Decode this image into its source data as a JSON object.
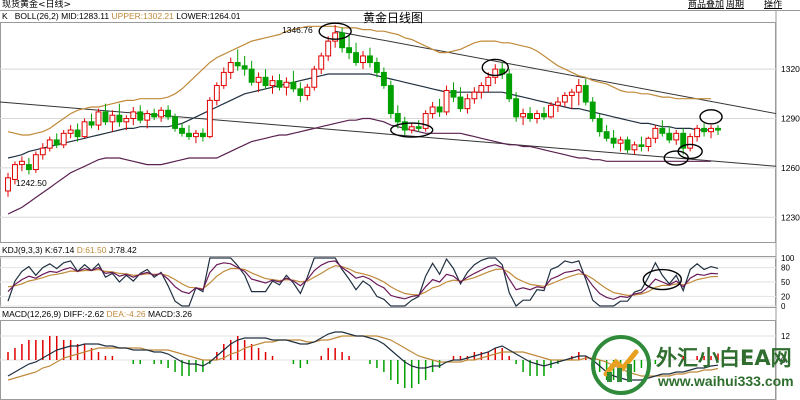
{
  "window": {
    "title": "现货黄金<日线>",
    "links": [
      "商品叠加",
      "周期",
      "操作"
    ]
  },
  "price_panel": {
    "header_prefix": "K",
    "boll_label": "BOLL(26,2)",
    "mid": "MID:1283.11",
    "upper": "UPPER:1302.21",
    "lower": "LOWER:1264.01",
    "chart_title": "黄金日线图",
    "high_label": "1346.76",
    "low_label": "1242.50",
    "axis_ticks": [
      "1320",
      "1290",
      "1260",
      "1230"
    ]
  },
  "kdj_panel": {
    "label": "KDJ(9,3,3)",
    "k": "K:67.14",
    "d": "D:61.50",
    "j": "J:78.42",
    "axis_ticks": [
      "100",
      "80",
      "50",
      "20",
      "0"
    ]
  },
  "macd_panel": {
    "label": "MACD(12,26,9)",
    "diff": "DIFF:-2.62",
    "dea": "DEA:-4.26",
    "macd": "MACD:3.26",
    "axis_ticks": [
      "12",
      "0"
    ]
  },
  "watermark": {
    "brand": "外汇小白EA网",
    "url": "www.waihui333.com"
  },
  "colors": {
    "up": "#e00000",
    "down": "#00a000",
    "boll_upper": "#c08a3a",
    "boll_mid": "#203040",
    "boll_lower": "#5a2050",
    "k_line": "#6a1a5a",
    "d_line": "#c08a3a",
    "j_line": "#203040",
    "trendline": "#333333",
    "ellipse": "#000000"
  },
  "chart_data": {
    "type": "candlestick",
    "ohlc": [
      [
        1246,
        1257,
        1242.5,
        1254
      ],
      [
        1253,
        1264,
        1250,
        1262
      ],
      [
        1262,
        1267,
        1258,
        1264
      ],
      [
        1262,
        1266,
        1256,
        1259
      ],
      [
        1259,
        1270,
        1257,
        1268
      ],
      [
        1268,
        1275,
        1265,
        1272
      ],
      [
        1272,
        1279,
        1270,
        1277
      ],
      [
        1277,
        1281,
        1272,
        1274
      ],
      [
        1274,
        1283,
        1272,
        1281
      ],
      [
        1281,
        1286,
        1278,
        1283
      ],
      [
        1283,
        1287,
        1276,
        1279
      ],
      [
        1279,
        1290,
        1278,
        1288
      ],
      [
        1288,
        1293,
        1284,
        1286
      ],
      [
        1286,
        1296,
        1283,
        1294
      ],
      [
        1294,
        1299,
        1286,
        1288
      ],
      [
        1288,
        1295,
        1282,
        1292
      ],
      [
        1292,
        1299,
        1285,
        1288
      ],
      [
        1288,
        1292,
        1283,
        1290
      ],
      [
        1290,
        1297,
        1286,
        1294
      ],
      [
        1294,
        1298,
        1287,
        1289
      ],
      [
        1289,
        1295,
        1284,
        1293
      ],
      [
        1293,
        1296,
        1289,
        1291
      ],
      [
        1291,
        1297,
        1288,
        1295
      ],
      [
        1295,
        1298,
        1289,
        1291
      ],
      [
        1291,
        1293,
        1282,
        1284
      ],
      [
        1284,
        1287,
        1279,
        1281
      ],
      [
        1281,
        1286,
        1277,
        1279
      ],
      [
        1279,
        1283,
        1275,
        1281
      ],
      [
        1281,
        1284,
        1276,
        1279
      ],
      [
        1279,
        1303,
        1278,
        1301
      ],
      [
        1301,
        1312,
        1298,
        1310
      ],
      [
        1310,
        1321,
        1308,
        1318
      ],
      [
        1318,
        1327,
        1314,
        1324
      ],
      [
        1324,
        1332,
        1319,
        1322
      ],
      [
        1322,
        1328,
        1316,
        1320
      ],
      [
        1320,
        1325,
        1310,
        1312
      ],
      [
        1312,
        1318,
        1306,
        1315
      ],
      [
        1315,
        1320,
        1308,
        1310
      ],
      [
        1310,
        1316,
        1305,
        1313
      ],
      [
        1313,
        1317,
        1307,
        1309
      ],
      [
        1309,
        1315,
        1304,
        1312
      ],
      [
        1312,
        1319,
        1306,
        1308
      ],
      [
        1308,
        1312,
        1300,
        1304
      ],
      [
        1304,
        1311,
        1301,
        1309
      ],
      [
        1309,
        1322,
        1307,
        1320
      ],
      [
        1320,
        1330,
        1317,
        1328
      ],
      [
        1328,
        1340,
        1325,
        1337
      ],
      [
        1337,
        1346.76,
        1333,
        1342
      ],
      [
        1342,
        1345,
        1330,
        1333
      ],
      [
        1333,
        1340,
        1326,
        1330
      ],
      [
        1330,
        1336,
        1322,
        1324
      ],
      [
        1324,
        1331,
        1320,
        1328
      ],
      [
        1328,
        1333,
        1321,
        1324
      ],
      [
        1324,
        1327,
        1315,
        1318
      ],
      [
        1318,
        1321,
        1308,
        1310
      ],
      [
        1310,
        1313,
        1290,
        1293
      ],
      [
        1293,
        1298,
        1284,
        1288
      ],
      [
        1288,
        1291,
        1280,
        1283
      ],
      [
        1283,
        1287,
        1281,
        1285
      ],
      [
        1285,
        1289,
        1282,
        1284
      ],
      [
        1284,
        1295,
        1282,
        1293
      ],
      [
        1293,
        1300,
        1290,
        1297
      ],
      [
        1297,
        1302,
        1291,
        1294
      ],
      [
        1294,
        1310,
        1292,
        1307
      ],
      [
        1307,
        1312,
        1300,
        1303
      ],
      [
        1303,
        1309,
        1294,
        1296
      ],
      [
        1296,
        1305,
        1293,
        1302
      ],
      [
        1302,
        1309,
        1299,
        1306
      ],
      [
        1306,
        1312,
        1302,
        1310
      ],
      [
        1310,
        1318,
        1306,
        1315
      ],
      [
        1315,
        1323,
        1311,
        1320
      ],
      [
        1320,
        1324,
        1314,
        1317
      ],
      [
        1317,
        1320,
        1300,
        1302
      ],
      [
        1302,
        1306,
        1288,
        1291
      ],
      [
        1291,
        1296,
        1286,
        1293
      ],
      [
        1293,
        1297,
        1288,
        1290
      ],
      [
        1290,
        1295,
        1287,
        1293
      ],
      [
        1293,
        1297,
        1289,
        1291
      ],
      [
        1291,
        1300,
        1290,
        1298
      ],
      [
        1298,
        1303,
        1294,
        1300
      ],
      [
        1300,
        1306,
        1297,
        1304
      ],
      [
        1304,
        1308,
        1296,
        1306
      ],
      [
        1306,
        1314,
        1298,
        1310
      ],
      [
        1310,
        1314,
        1298,
        1300
      ],
      [
        1300,
        1303,
        1288,
        1290
      ],
      [
        1290,
        1293,
        1279,
        1282
      ],
      [
        1282,
        1286,
        1276,
        1278
      ],
      [
        1278,
        1283,
        1272,
        1275
      ],
      [
        1275,
        1279,
        1270,
        1277
      ],
      [
        1277,
        1279,
        1269,
        1271
      ],
      [
        1271,
        1276,
        1268,
        1274
      ],
      [
        1274,
        1279,
        1270,
        1273
      ],
      [
        1273,
        1279,
        1270,
        1278
      ],
      [
        1278,
        1286,
        1275,
        1284
      ],
      [
        1284,
        1289,
        1279,
        1281
      ],
      [
        1281,
        1285,
        1275,
        1277
      ],
      [
        1277,
        1283,
        1274,
        1281
      ],
      [
        1281,
        1284,
        1268,
        1272
      ],
      [
        1272,
        1281,
        1270,
        1279
      ],
      [
        1279,
        1286,
        1276,
        1284
      ],
      [
        1284,
        1287,
        1279,
        1282
      ],
      [
        1282,
        1286,
        1278,
        1284
      ],
      [
        1284,
        1286,
        1280,
        1283
      ]
    ],
    "boll_upper": [
      1282,
      1281,
      1280,
      1280,
      1281,
      1282,
      1284,
      1287,
      1290,
      1293,
      1295,
      1296,
      1297,
      1297,
      1298,
      1299,
      1300,
      1301,
      1301,
      1302,
      1302,
      1302,
      1302,
      1303,
      1305,
      1308,
      1312,
      1316,
      1320,
      1324,
      1327,
      1329,
      1331,
      1333,
      1335,
      1337,
      1338,
      1339,
      1340,
      1341,
      1343,
      1344,
      1345,
      1346,
      1346,
      1346,
      1346,
      1346,
      1345,
      1345,
      1345,
      1344,
      1344,
      1343,
      1343,
      1342,
      1341,
      1339,
      1338,
      1336,
      1334,
      1332,
      1330,
      1330,
      1331,
      1332,
      1334,
      1336,
      1337,
      1337,
      1337,
      1336,
      1336,
      1335,
      1334,
      1333,
      1331,
      1328,
      1325,
      1322,
      1320,
      1318,
      1316,
      1315,
      1313,
      1312,
      1311,
      1309,
      1307,
      1306,
      1306,
      1305,
      1305,
      1304,
      1303,
      1303,
      1302,
      1302,
      1302,
      1302,
      1302,
      1302
    ],
    "boll_mid": [
      1266,
      1267,
      1268,
      1270,
      1271,
      1272,
      1273,
      1274,
      1275,
      1276,
      1277,
      1278,
      1279,
      1280,
      1281,
      1282,
      1283,
      1284,
      1284,
      1285,
      1285,
      1285,
      1285,
      1285,
      1286,
      1287,
      1289,
      1291,
      1293,
      1295,
      1297,
      1299,
      1301,
      1303,
      1305,
      1306,
      1307,
      1308,
      1309,
      1310,
      1311,
      1312,
      1313,
      1314,
      1315,
      1316,
      1317,
      1317,
      1317,
      1317,
      1317,
      1317,
      1317,
      1316,
      1315,
      1314,
      1313,
      1312,
      1311,
      1310,
      1309,
      1308,
      1307,
      1306,
      1306,
      1306,
      1306,
      1306,
      1306,
      1306,
      1306,
      1306,
      1305,
      1304,
      1303,
      1302,
      1301,
      1300,
      1299,
      1298,
      1297,
      1296,
      1296,
      1295,
      1294,
      1293,
      1292,
      1291,
      1290,
      1289,
      1288,
      1287,
      1287,
      1286,
      1285,
      1285,
      1284,
      1284,
      1284,
      1283,
      1283,
      1283
    ],
    "boll_lower": [
      1232,
      1234,
      1236,
      1239,
      1242,
      1245,
      1248,
      1251,
      1254,
      1257,
      1259,
      1261,
      1263,
      1265,
      1266,
      1266,
      1266,
      1265,
      1264,
      1263,
      1262,
      1262,
      1262,
      1263,
      1264,
      1265,
      1266,
      1266,
      1266,
      1266,
      1266,
      1268,
      1270,
      1272,
      1274,
      1276,
      1277,
      1278,
      1279,
      1280,
      1280,
      1281,
      1282,
      1283,
      1284,
      1285,
      1286,
      1287,
      1288,
      1289,
      1289,
      1290,
      1290,
      1289,
      1288,
      1286,
      1285,
      1284,
      1283,
      1282,
      1281,
      1281,
      1281,
      1281,
      1281,
      1281,
      1280,
      1279,
      1278,
      1277,
      1276,
      1275,
      1274,
      1274,
      1273,
      1273,
      1272,
      1271,
      1270,
      1269,
      1268,
      1267,
      1266,
      1266,
      1265,
      1265,
      1264,
      1264,
      1264,
      1264,
      1264,
      1264,
      1264,
      1264,
      1264,
      1264,
      1264,
      1264,
      1264,
      1264,
      1264,
      1264
    ],
    "ylim": [
      1215,
      1348
    ],
    "kdj": {
      "k": [
        30,
        45,
        55,
        62,
        58,
        66,
        72,
        70,
        76,
        80,
        72,
        78,
        74,
        80,
        68,
        70,
        62,
        66,
        60,
        66,
        70,
        64,
        68,
        56,
        40,
        30,
        26,
        38,
        34,
        70,
        86,
        90,
        88,
        80,
        72,
        56,
        52,
        48,
        54,
        50,
        58,
        52,
        42,
        55,
        74,
        85,
        92,
        94,
        80,
        70,
        58,
        62,
        56,
        45,
        38,
        22,
        18,
        15,
        20,
        22,
        40,
        55,
        50,
        66,
        62,
        50,
        60,
        68,
        75,
        82,
        86,
        80,
        56,
        34,
        38,
        34,
        40,
        38,
        56,
        62,
        70,
        72,
        76,
        62,
        42,
        26,
        18,
        14,
        20,
        18,
        25,
        28,
        40,
        56,
        50,
        44,
        52,
        40,
        58,
        66,
        64,
        68,
        67
      ],
      "d": [
        40,
        42,
        46,
        52,
        55,
        59,
        64,
        66,
        69,
        73,
        72,
        74,
        74,
        76,
        72,
        71,
        68,
        67,
        64,
        65,
        67,
        66,
        67,
        63,
        55,
        46,
        39,
        38,
        36,
        48,
        62,
        72,
        78,
        78,
        76,
        69,
        63,
        57,
        55,
        53,
        55,
        54,
        50,
        52,
        60,
        68,
        77,
        84,
        82,
        77,
        70,
        67,
        63,
        57,
        50,
        40,
        32,
        26,
        24,
        23,
        29,
        38,
        42,
        50,
        54,
        52,
        55,
        59,
        65,
        71,
        76,
        77,
        70,
        58,
        51,
        45,
        43,
        41,
        46,
        52,
        58,
        63,
        67,
        65,
        57,
        46,
        36,
        28,
        25,
        22,
        23,
        25,
        30,
        39,
        43,
        43,
        46,
        44,
        49,
        55,
        58,
        61,
        61.5
      ],
      "j": [
        10,
        52,
        72,
        82,
        64,
        80,
        88,
        78,
        90,
        94,
        72,
        86,
        74,
        88,
        60,
        68,
        50,
        64,
        52,
        68,
        76,
        60,
        70,
        42,
        10,
        0,
        0,
        38,
        30,
        100,
        100,
        100,
        100,
        84,
        64,
        30,
        30,
        30,
        52,
        44,
        64,
        48,
        26,
        60,
        100,
        100,
        100,
        100,
        76,
        56,
        34,
        52,
        42,
        20,
        14,
        0,
        0,
        0,
        12,
        20,
        62,
        89,
        66,
        98,
        78,
        46,
        70,
        86,
        95,
        100,
        100,
        86,
        28,
        0,
        12,
        12,
        34,
        32,
        76,
        82,
        94,
        90,
        94,
        56,
        12,
        0,
        0,
        0,
        10,
        10,
        29,
        34,
        60,
        90,
        64,
        46,
        64,
        32,
        76,
        88,
        76,
        82,
        78.4
      ]
    },
    "macd": {
      "diff": [
        -8,
        -6,
        -4,
        -2,
        -1,
        1,
        3,
        5,
        6,
        7,
        7,
        8,
        8,
        8,
        7,
        7,
        6,
        6,
        5,
        5,
        5,
        4,
        4,
        3,
        1,
        -1,
        -2,
        -2,
        -3,
        -1,
        2,
        5,
        8,
        10,
        11,
        11,
        11,
        11,
        10,
        10,
        10,
        9,
        8,
        8,
        9,
        11,
        13,
        14,
        14,
        13,
        12,
        12,
        11,
        10,
        8,
        5,
        2,
        -1,
        -3,
        -4,
        -4,
        -3,
        -3,
        -1,
        0,
        0,
        1,
        2,
        3,
        4,
        6,
        7,
        5,
        3,
        1,
        -1,
        -2,
        -3,
        -2,
        -1,
        0,
        1,
        2,
        2,
        0,
        -3,
        -6,
        -8,
        -9,
        -10,
        -10,
        -10,
        -9,
        -8,
        -7,
        -7,
        -6,
        -6,
        -5,
        -4,
        -4,
        -3,
        -2.62
      ],
      "dea": [
        -10,
        -9,
        -8,
        -7,
        -6,
        -4,
        -3,
        -1,
        1,
        2,
        3,
        4,
        5,
        6,
        6,
        6,
        6,
        6,
        6,
        6,
        5,
        5,
        5,
        5,
        4,
        3,
        2,
        1,
        0,
        0,
        0,
        1,
        3,
        4,
        6,
        7,
        8,
        9,
        9,
        10,
        10,
        10,
        10,
        9,
        9,
        10,
        10,
        11,
        12,
        12,
        12,
        12,
        12,
        12,
        11,
        10,
        8,
        6,
        4,
        2,
        1,
        0,
        -1,
        -1,
        -1,
        -1,
        0,
        0,
        1,
        2,
        3,
        4,
        4,
        4,
        4,
        3,
        2,
        1,
        0,
        0,
        0,
        0,
        0,
        1,
        1,
        0,
        -1,
        -3,
        -4,
        -6,
        -7,
        -8,
        -8,
        -8,
        -8,
        -8,
        -7,
        -7,
        -6,
        -6,
        -5,
        -5,
        -4.26
      ],
      "hist": [
        4,
        6,
        8,
        10,
        10,
        10,
        12,
        12,
        10,
        10,
        8,
        8,
        6,
        4,
        2,
        2,
        0,
        0,
        -2,
        -2,
        0,
        -2,
        -2,
        -4,
        -6,
        -8,
        -8,
        -6,
        -6,
        -2,
        4,
        8,
        10,
        12,
        10,
        8,
        6,
        4,
        2,
        0,
        0,
        -2,
        -4,
        -2,
        0,
        2,
        6,
        6,
        4,
        2,
        0,
        0,
        -2,
        -4,
        -6,
        -10,
        -12,
        -14,
        -14,
        -12,
        -10,
        -6,
        -4,
        0,
        2,
        2,
        2,
        4,
        4,
        4,
        6,
        6,
        2,
        -2,
        -6,
        -8,
        -8,
        -8,
        -4,
        -2,
        0,
        2,
        4,
        2,
        -2,
        -6,
        -10,
        -10,
        -10,
        -8,
        -6,
        -4,
        -2,
        -2,
        0,
        2,
        0,
        2,
        0,
        2,
        2,
        2,
        3.26
      ]
    }
  }
}
